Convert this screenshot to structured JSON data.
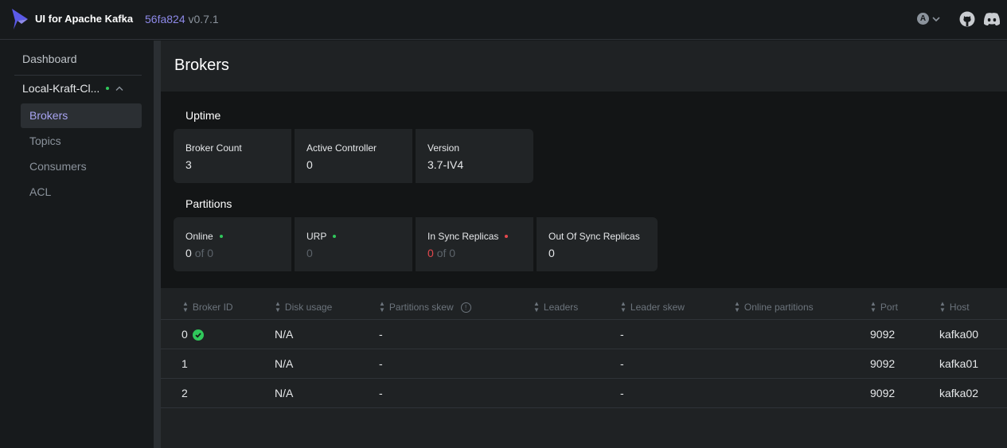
{
  "header": {
    "brand": "UI for Apache Kafka",
    "commit_hash": "56fa824",
    "version": "v0.7.1",
    "user_initial": "A",
    "icons": [
      "kafka-logo-icon",
      "user-icon",
      "chevron-down-icon",
      "github-icon",
      "discord-icon"
    ]
  },
  "sidebar": {
    "dashboard": "Dashboard",
    "cluster": {
      "name": "Local-Kraft-Cl...",
      "status": "online"
    },
    "items": [
      {
        "label": "Brokers",
        "active": true
      },
      {
        "label": "Topics",
        "active": false
      },
      {
        "label": "Consumers",
        "active": false
      },
      {
        "label": "ACL",
        "active": false
      }
    ]
  },
  "page": {
    "title": "Brokers"
  },
  "uptime": {
    "title": "Uptime",
    "cards": [
      {
        "label": "Broker Count",
        "value": "3"
      },
      {
        "label": "Active Controller",
        "value": "0"
      },
      {
        "label": "Version",
        "value": "3.7-IV4"
      }
    ]
  },
  "partitions": {
    "title": "Partitions",
    "cards": [
      {
        "label": "Online",
        "value": "0",
        "suffix": "of 0",
        "indicator": "green"
      },
      {
        "label": "URP",
        "value": "0",
        "indicator": "green"
      },
      {
        "label": "In Sync Replicas",
        "value": "0",
        "suffix": "of 0",
        "indicator": "red"
      },
      {
        "label": "Out Of Sync Replicas",
        "value": "0"
      }
    ]
  },
  "table": {
    "columns": [
      "Broker ID",
      "Disk usage",
      "Partitions skew",
      "Leaders",
      "Leader skew",
      "Online partitions",
      "Port",
      "Host"
    ],
    "rows": [
      {
        "broker_id": "0",
        "controller": true,
        "disk_usage": "N/A",
        "partitions_skew": "-",
        "leaders": "",
        "leader_skew": "-",
        "online_partitions": "",
        "port": "9092",
        "host": "kafka00"
      },
      {
        "broker_id": "1",
        "controller": false,
        "disk_usage": "N/A",
        "partitions_skew": "-",
        "leaders": "",
        "leader_skew": "-",
        "online_partitions": "",
        "port": "9092",
        "host": "kafka01"
      },
      {
        "broker_id": "2",
        "controller": false,
        "disk_usage": "N/A",
        "partitions_skew": "-",
        "leaders": "",
        "leader_skew": "-",
        "online_partitions": "",
        "port": "9092",
        "host": "kafka02"
      }
    ]
  },
  "colors": {
    "accent": "#8d89e8",
    "green": "#30c85b",
    "red": "#e5484d",
    "background": "#171a1c"
  }
}
